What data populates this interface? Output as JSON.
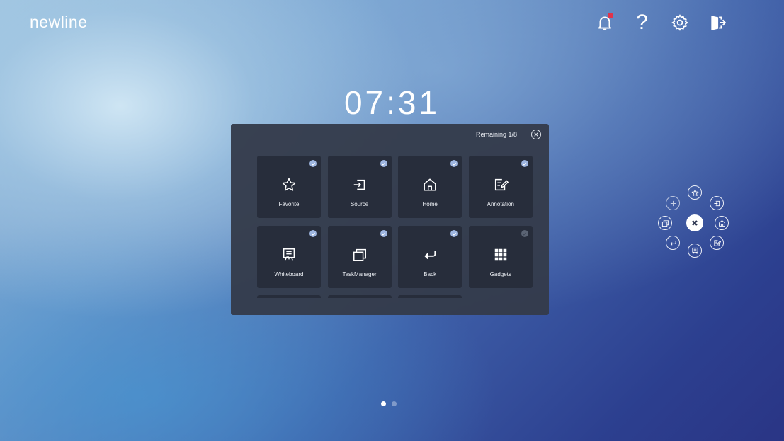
{
  "header": {
    "logo_text": "newline",
    "icons": [
      "bell-icon",
      "help-icon",
      "gear-icon",
      "exit-icon"
    ],
    "help_glyph": "?",
    "notification_color": "#e0334a"
  },
  "clock": {
    "time": "07:31"
  },
  "panel": {
    "remaining": "Remaining 1/8",
    "tiles": [
      {
        "label": "Favorite",
        "icon": "star-icon",
        "checked": true
      },
      {
        "label": "Source",
        "icon": "source-icon",
        "checked": true
      },
      {
        "label": "Home",
        "icon": "home-icon",
        "checked": true
      },
      {
        "label": "Annotation",
        "icon": "annotation-icon",
        "checked": true
      },
      {
        "label": "Whiteboard",
        "icon": "whiteboard-icon",
        "checked": true
      },
      {
        "label": "TaskManager",
        "icon": "task-manager-icon",
        "checked": true
      },
      {
        "label": "Back",
        "icon": "back-icon",
        "checked": true
      },
      {
        "label": "Gadgets",
        "icon": "gadgets-icon",
        "checked": false
      }
    ],
    "check_color": "#9db5e0"
  },
  "floating_menu": {
    "buttons": [
      "star-icon",
      "source-icon",
      "home-icon",
      "annotation-icon",
      "whiteboard-icon",
      "back-icon",
      "task-manager-icon",
      "add-icon",
      "close-icon"
    ]
  },
  "pagination": {
    "pages": 2,
    "active": 1
  }
}
